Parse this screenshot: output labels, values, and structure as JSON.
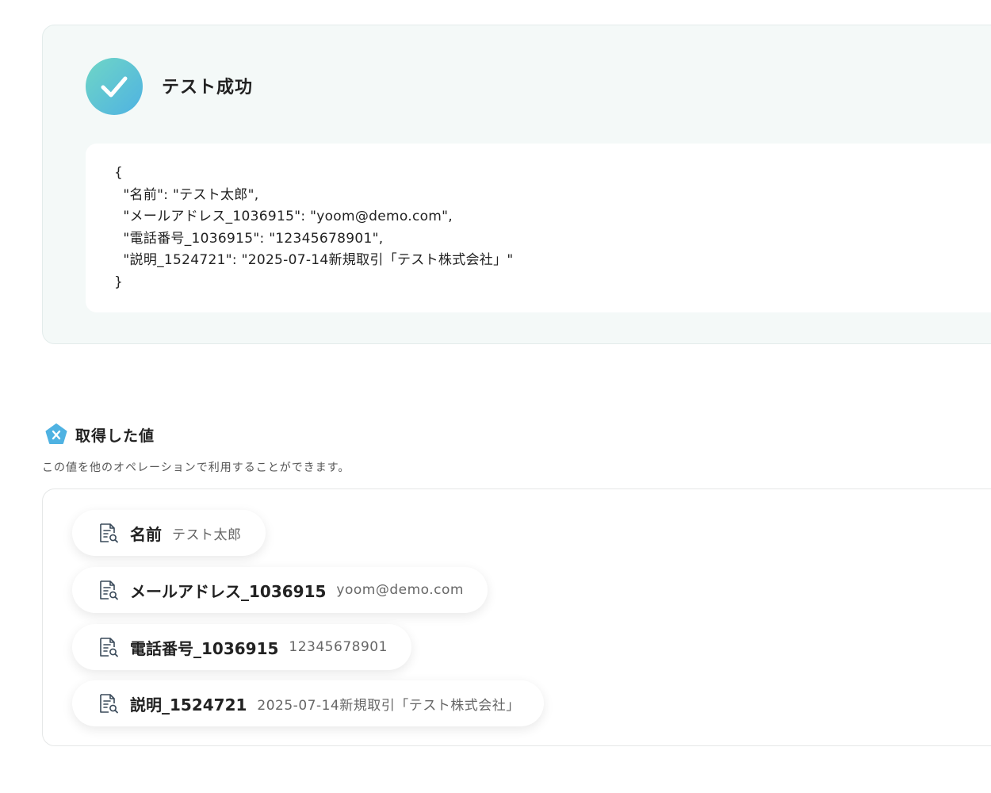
{
  "test_result": {
    "status_title": "テスト成功",
    "json_lines": [
      "{",
      "  \"名前\": \"テスト太郎\",",
      "  \"メールアドレス_1036915\": \"yoom@demo.com\",",
      "  \"電話番号_1036915\": \"12345678901\",",
      "  \"説明_1524721\": \"2025-07-14新規取引「テスト株式会社」\"",
      "}"
    ]
  },
  "retrieved_values": {
    "title": "取得した値",
    "description": "この値を他のオペレーションで利用することができます。",
    "items": [
      {
        "key": "名前",
        "value": "テスト太郎"
      },
      {
        "key": "メールアドレス_1036915",
        "value": "yoom@demo.com"
      },
      {
        "key": "電話番号_1036915",
        "value": "12345678901"
      },
      {
        "key": "説明_1524721",
        "value": "2025-07-14新規取引「テスト株式会社」"
      }
    ]
  },
  "icons": {
    "success": "check-icon",
    "section": "variable-x-icon",
    "item": "document-search-icon"
  },
  "colors": {
    "success_gradient_start": "#6fd6c6",
    "success_gradient_end": "#4fb2e2",
    "section_icon": "#4fb2e2",
    "result_background": "#f4f9f8"
  }
}
